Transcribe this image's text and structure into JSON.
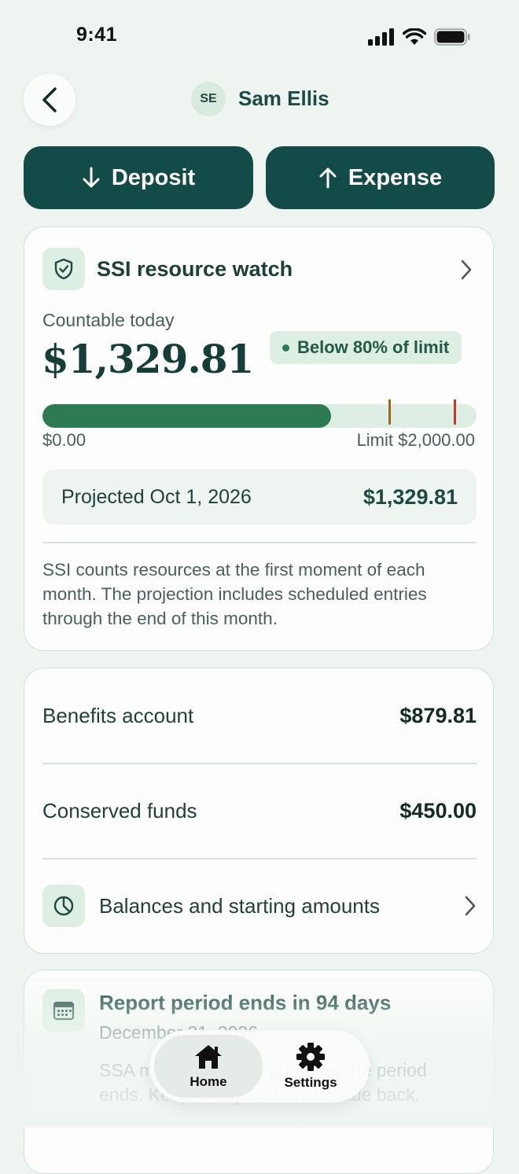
{
  "status_bar": {
    "time": "9:41"
  },
  "header": {
    "avatar_initials": "SE",
    "user_name": "Sam Ellis"
  },
  "actions": {
    "deposit_label": "Deposit",
    "expense_label": "Expense"
  },
  "ssi_card": {
    "title": "SSI resource watch",
    "countable_label": "Countable today",
    "countable_amount": "$1,329.81",
    "status_pill": "Below 80% of limit",
    "progress_fraction": 0.665,
    "threshold_markers": [
      {
        "fraction": 0.8,
        "color": "#9a6a14"
      },
      {
        "fraction": 0.95,
        "color": "#c0392b"
      }
    ],
    "bar_min_label": "$0.00",
    "bar_max_label": "Limit $2,000.00",
    "projected_label": "Projected Oct 1, 2026",
    "projected_value": "$1,329.81",
    "note": "SSI counts resources at the first moment of each month. The projection includes scheduled entries through the end of this month."
  },
  "balances_card": {
    "rows": [
      {
        "label": "Benefits account",
        "value": "$879.81"
      },
      {
        "label": "Conserved funds",
        "value": "$450.00"
      }
    ],
    "link_label": "Balances and starting amounts"
  },
  "report_card": {
    "title": "Report period ends in 94 days",
    "date": "December 31, 2026",
    "body": "SSA may ask for a report after the period ends. Keep receipts; then it is due back."
  },
  "tab_bar": {
    "home_label": "Home",
    "settings_label": "Settings"
  },
  "colors": {
    "accent": "#134b48",
    "progress": "#2d7a55",
    "background": "#eef5f0"
  }
}
